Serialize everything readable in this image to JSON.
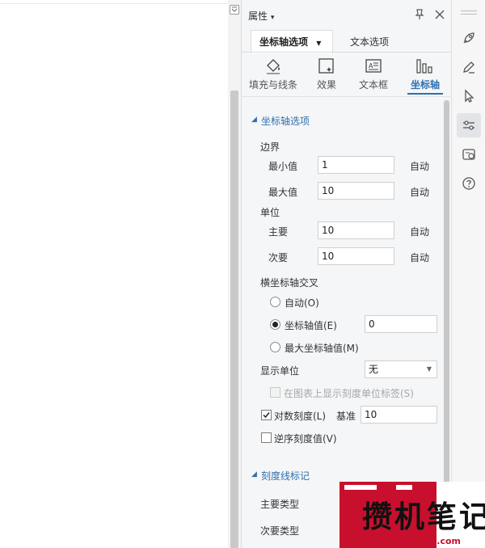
{
  "panel": {
    "title": "属性",
    "title_caret": "▾",
    "tabs": [
      {
        "label": "坐标轴选项",
        "caret": "▼",
        "active": true
      },
      {
        "label": "文本选项",
        "active": false
      }
    ],
    "icon_tabs": [
      {
        "label": "填充与线条",
        "icon": "fill-bucket-icon"
      },
      {
        "label": "效果",
        "icon": "effects-icon"
      },
      {
        "label": "文本框",
        "icon": "textbox-icon"
      },
      {
        "label": "坐标轴",
        "icon": "axis-bars-icon",
        "active": true
      }
    ],
    "section_axis": "坐标轴选项",
    "bounds_label": "边界",
    "min_label": "最小值",
    "min_value": "1",
    "min_auto": "自动",
    "max_label": "最大值",
    "max_value": "10",
    "max_auto": "自动",
    "units_label": "单位",
    "major_label": "主要",
    "major_value": "10",
    "major_auto": "自动",
    "minor_label": "次要",
    "minor_value": "10",
    "minor_auto": "自动",
    "cross_label": "横坐标轴交叉",
    "radio_auto": "自动(O)",
    "radio_axis_value": "坐标轴值(E)",
    "axis_value_input": "0",
    "radio_max": "最大坐标轴值(M)",
    "display_units_label": "显示单位",
    "display_units_value": "无",
    "show_units_label": "在图表上显示刻度单位标签(S)",
    "log_scale_label": "对数刻度(L)",
    "log_scale_checked": true,
    "base_label": "基准",
    "base_value": "10",
    "reverse_label": "逆序刻度值(V)",
    "reverse_checked": false,
    "section_ticks": "刻度线标记",
    "major_type_label": "主要类型",
    "minor_type_label": "次要类型"
  },
  "watermark": {
    "title": "攒机笔记",
    "url": "www.cuanjibiji.com"
  },
  "colors": {
    "accent": "#2f6fb2",
    "watermark_red": "#c8102e"
  }
}
